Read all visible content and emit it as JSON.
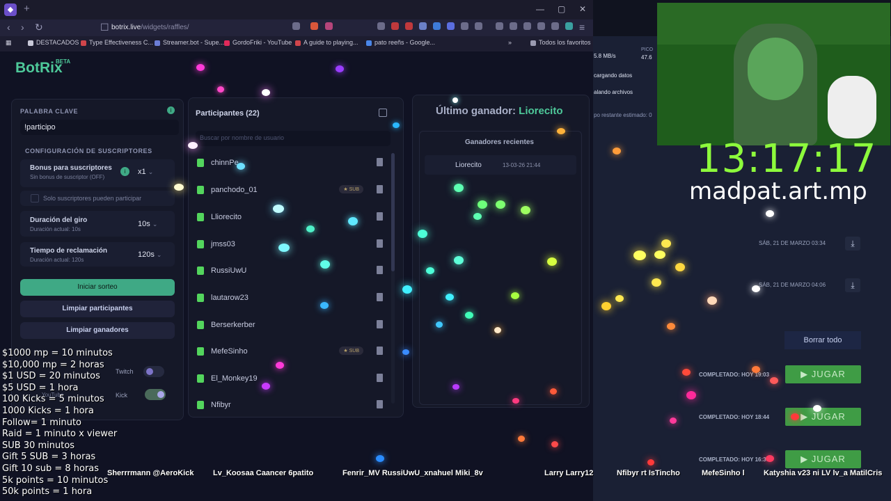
{
  "browser": {
    "url_host": "botrix.live",
    "url_path": "/widgets/raffles/",
    "bookmarks": [
      "DESTACADOS",
      "Type Effectiveness C...",
      "Streamer.bot - Supe...",
      "GordoFriki - YouTube",
      "A guide to playing...",
      "pato reeñs - Google..."
    ],
    "bookmarks_all": "Todos los favoritos"
  },
  "app": {
    "logo": "BotRix",
    "beta": "BETA",
    "keyword": {
      "label": "PALABRA CLAVE",
      "value": "!participo"
    },
    "subs_config_label": "CONFIGURACIÓN DE SUSCRIPTORES",
    "bonus": {
      "title": "Bonus para suscriptores",
      "desc": "Sin bonus de suscriptor (OFF)",
      "value": "x1"
    },
    "only_subs": "Solo suscriptores pueden participar",
    "spin": {
      "title": "Duración del giro",
      "desc": "Duración actual: 10s",
      "value": "10s"
    },
    "claim": {
      "title": "Tiempo de reclamación",
      "desc": "Duración actual: 120s",
      "value": "120s"
    },
    "start_button": "Iniciar sorteo",
    "clear_participants": "Limpiar participantes",
    "clear_winners": "Limpiar ganadores",
    "twitch": "Twitch",
    "kick": "Kick",
    "youtube": "YouTube",
    "participants_title": "Participantes (22)",
    "search_placeholder": "Buscar por nombre de usuario",
    "participants": [
      {
        "name": "chinnPe",
        "sub": ""
      },
      {
        "name": "panchodo_01",
        "sub": "SUB"
      },
      {
        "name": "Lliorecito",
        "sub": ""
      },
      {
        "name": "jmss03",
        "sub": ""
      },
      {
        "name": "RussiUwU",
        "sub": ""
      },
      {
        "name": "lautarow23",
        "sub": ""
      },
      {
        "name": "Berserkerber",
        "sub": ""
      },
      {
        "name": "MefeSinho",
        "sub": "SUB"
      },
      {
        "name": "El_Monkey19",
        "sub": ""
      },
      {
        "name": "Nfibyr",
        "sub": ""
      }
    ],
    "last_winner_label": "Último ganador:",
    "last_winner": "Liorecito",
    "recent_winners_title": "Ganadores recientes",
    "recent_winner": {
      "name": "Liorecito",
      "date": "13-03-26 21:44"
    }
  },
  "right": {
    "speed": "5.8 MB/s",
    "peak": "PICO",
    "peak_val": "47.6",
    "loading": "cargando datos",
    "files": "alando archivos",
    "remaining": "po restante estimado: 0",
    "timer": "13:17:17",
    "handle": "madpat.art.mp",
    "date1": "SÁB, 21 DE MARZO 03:34",
    "date2": "SÁB, 21 DE MARZO 04:06",
    "clear_all": "Borrar todo",
    "completed": [
      "COMPLETADO: HOY 19:03",
      "COMPLETADO: HOY 18:44",
      "COMPLETADO: HOY 16:35"
    ],
    "play": "▶ JUGAR"
  },
  "overlay": {
    "rates": [
      "$1000 mp = 10 minutos",
      "$10,000 mp = 2 horas",
      "$1 USD = 20 minutos",
      "$5 USD = 1 hora",
      "100 Kicks = 5 minutos",
      "1000 Kicks = 1 hora",
      "Follow= 1 minuto",
      "Raid = 1 minuto x viewer",
      "SUB 30 minutos",
      "Gift 5 SUB = 3 horas",
      "Gift 10 sub = 8 horas",
      "5k points = 10 minutos",
      "50k points = 1 hora"
    ],
    "names": [
      "Sherrrmann @AeroKick",
      "Lv_Koosaa Caancer 6patito",
      "Fenrir_MV RussiUwU_xnahuel Miki_8v",
      "Larry Larry12",
      "Nfibyr rt IsTincho",
      "MefeSinho l",
      "Katyshia v23 ni LV lv_a MatilCris"
    ]
  }
}
